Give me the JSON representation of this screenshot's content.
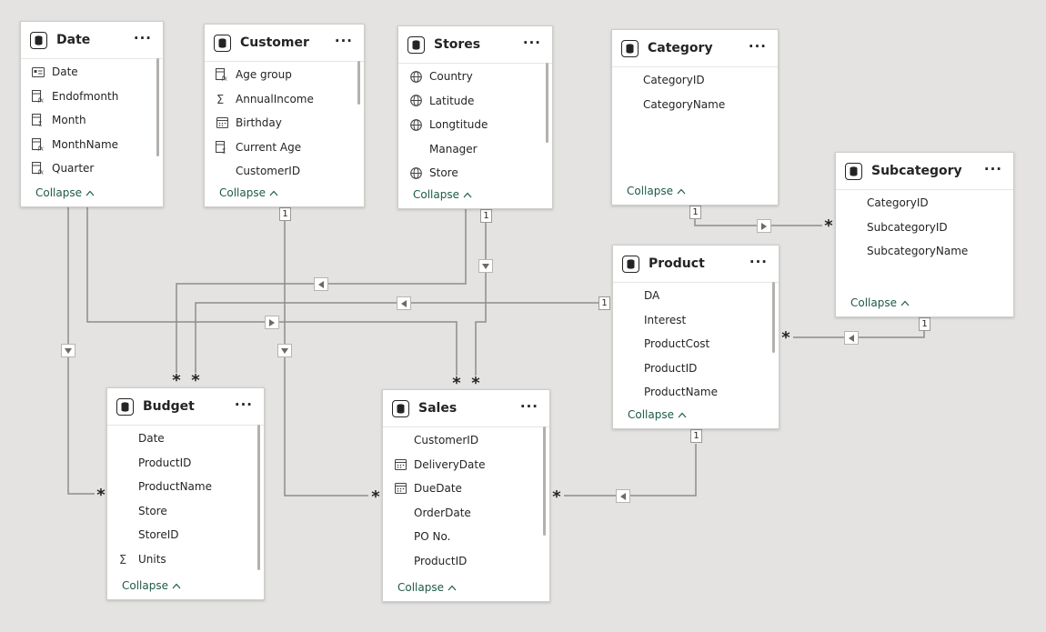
{
  "collapse_label": "Collapse",
  "one_label": "1",
  "many_label": "*",
  "tables": {
    "date": {
      "title": "Date",
      "fields": [
        {
          "name": "Date",
          "icon": "card-icon"
        },
        {
          "name": "Endofmonth",
          "icon": "calc-column-icon"
        },
        {
          "name": "Month",
          "icon": "calc-sum-icon"
        },
        {
          "name": "MonthName",
          "icon": "calc-column-icon"
        },
        {
          "name": "Quarter",
          "icon": "calc-column-icon"
        }
      ]
    },
    "customer": {
      "title": "Customer",
      "fields": [
        {
          "name": "Age group",
          "icon": "calc-column-icon"
        },
        {
          "name": "AnnualIncome",
          "icon": "sigma-icon"
        },
        {
          "name": "Birthday",
          "icon": "calendar-icon"
        },
        {
          "name": "Current Age",
          "icon": "calc-sum-icon"
        },
        {
          "name": "CustomerID",
          "icon": ""
        }
      ]
    },
    "stores": {
      "title": "Stores",
      "fields": [
        {
          "name": "Country",
          "icon": "globe-icon"
        },
        {
          "name": "Latitude",
          "icon": "globe-icon"
        },
        {
          "name": "Longtitude",
          "icon": "globe-icon"
        },
        {
          "name": "Manager",
          "icon": ""
        },
        {
          "name": "Store",
          "icon": "globe-icon"
        }
      ]
    },
    "category": {
      "title": "Category",
      "fields": [
        {
          "name": "CategoryID",
          "icon": ""
        },
        {
          "name": "CategoryName",
          "icon": ""
        }
      ]
    },
    "subcategory": {
      "title": "Subcategory",
      "fields": [
        {
          "name": "CategoryID",
          "icon": ""
        },
        {
          "name": "SubcategoryID",
          "icon": ""
        },
        {
          "name": "SubcategoryName",
          "icon": ""
        }
      ]
    },
    "product": {
      "title": "Product",
      "fields": [
        {
          "name": "DA",
          "icon": ""
        },
        {
          "name": "Interest",
          "icon": ""
        },
        {
          "name": "ProductCost",
          "icon": ""
        },
        {
          "name": "ProductID",
          "icon": ""
        },
        {
          "name": "ProductName",
          "icon": ""
        }
      ]
    },
    "budget": {
      "title": "Budget",
      "fields": [
        {
          "name": "Date",
          "icon": ""
        },
        {
          "name": "ProductID",
          "icon": ""
        },
        {
          "name": "ProductName",
          "icon": ""
        },
        {
          "name": "Store",
          "icon": ""
        },
        {
          "name": "StoreID",
          "icon": ""
        },
        {
          "name": "Units",
          "icon": "sigma-icon"
        }
      ]
    },
    "sales": {
      "title": "Sales",
      "fields": [
        {
          "name": "CustomerID",
          "icon": ""
        },
        {
          "name": "DeliveryDate",
          "icon": "calendar-icon"
        },
        {
          "name": "DueDate",
          "icon": "calendar-icon"
        },
        {
          "name": "OrderDate",
          "icon": ""
        },
        {
          "name": "PO No.",
          "icon": ""
        },
        {
          "name": "ProductID",
          "icon": ""
        }
      ]
    }
  },
  "relationships": [
    {
      "from": "Date",
      "to": "Budget",
      "one": "1",
      "many": "*"
    },
    {
      "from": "Date",
      "to": "Sales",
      "one": "1",
      "many": "*"
    },
    {
      "from": "Customer",
      "to": "Sales",
      "one": "1",
      "many": "*"
    },
    {
      "from": "Stores",
      "to": "Budget",
      "one": "1",
      "many": "*"
    },
    {
      "from": "Stores",
      "to": "Sales",
      "one": "1",
      "many": "*"
    },
    {
      "from": "Category",
      "to": "Subcategory",
      "one": "1",
      "many": "*"
    },
    {
      "from": "Subcategory",
      "to": "Product",
      "one": "1",
      "many": "*"
    },
    {
      "from": "Product",
      "to": "Budget",
      "one": "1",
      "many": "*"
    },
    {
      "from": "Product",
      "to": "Sales",
      "one": "1",
      "many": "*"
    }
  ]
}
